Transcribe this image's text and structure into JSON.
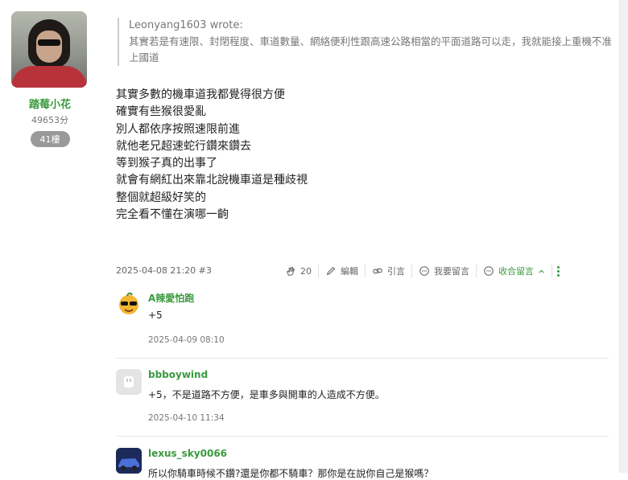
{
  "author": {
    "name": "踏莓小花",
    "score": "49653分",
    "floor": "41樓"
  },
  "quote": {
    "author": "Leonyang1603 wrote:",
    "text": "其實若是有速限、封閉程度、車道數量、網絡便利性跟高速公路相當的平面道路可以走，我就能接上重機不准上國道"
  },
  "post": {
    "lines": [
      "其實多數的機車道我都覺得很方便",
      "確實有些猴很愛亂",
      "別人都依序按照速限前進",
      "就他老兄超速蛇行鑽來鑽去",
      "等到猴子真的出事了",
      "就會有網紅出來靠北說機車道是種歧視",
      "整個就超級好笑的",
      "完全看不懂在演哪一齣"
    ],
    "meta": "2025-04-08 21:20 #3"
  },
  "actions": {
    "like_count": "20",
    "edit": "編輯",
    "quote": "引言",
    "comment": "我要留言",
    "collapse": "收合留言"
  },
  "comments": [
    {
      "name": "A辣愛怕跑",
      "text": "+5",
      "time": "2025-04-09 08:10"
    },
    {
      "name": "bbboywind",
      "text": "+5，不是道路不方便，是車多與開車的人造成不方便。",
      "time": "2025-04-10 11:34"
    },
    {
      "name": "lexus_sky0066",
      "text": "所以你騎車時候不鑽?還是你都不騎車？那你是在說你自己是猴嗎？",
      "time": ""
    }
  ],
  "colors": {
    "accent": "#3a9a3e",
    "muted": "#777777"
  }
}
